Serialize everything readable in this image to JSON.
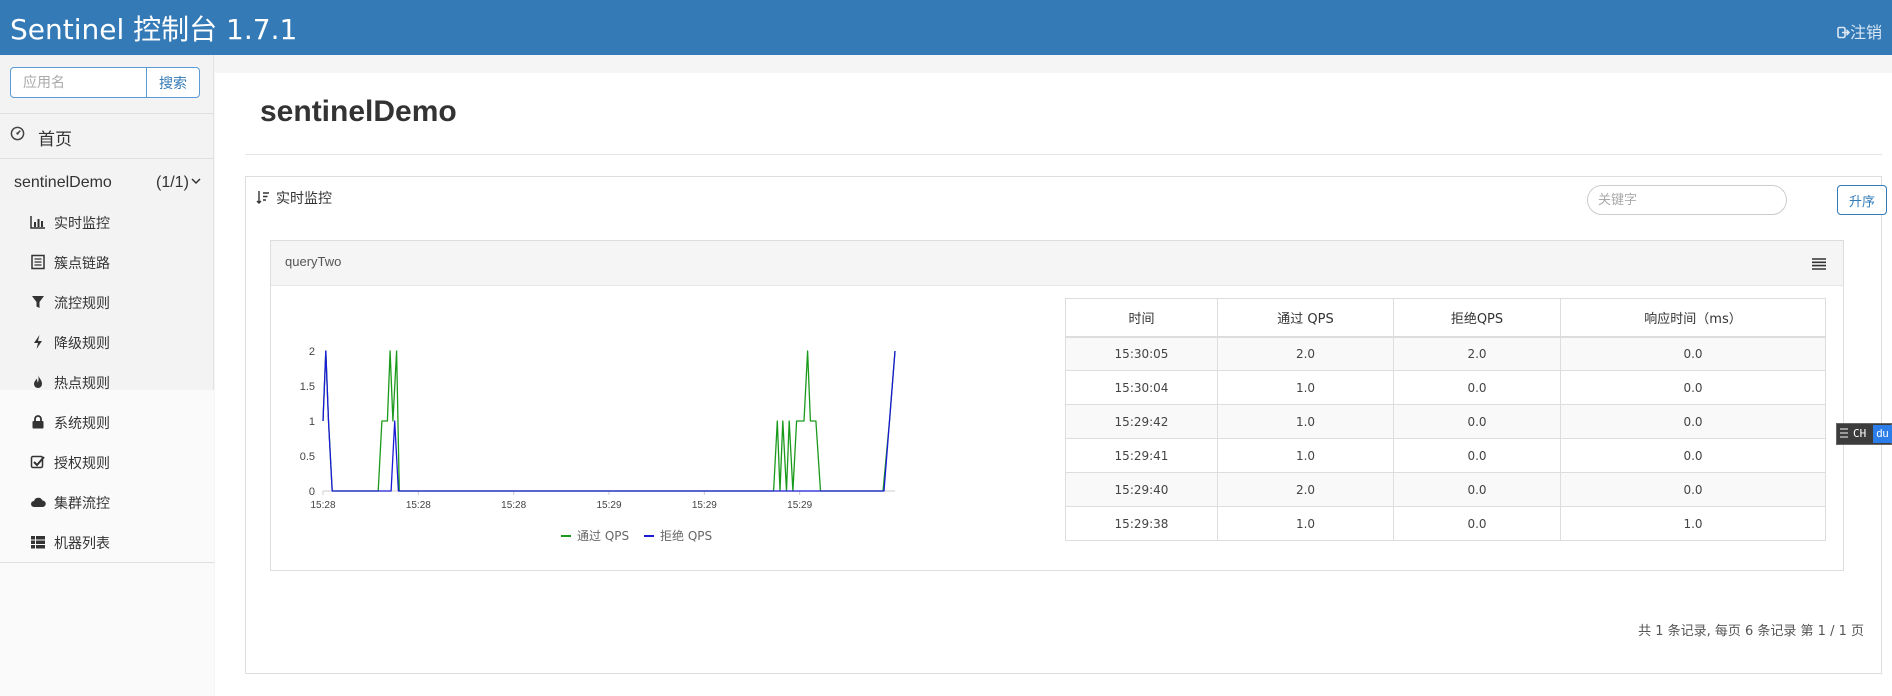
{
  "header": {
    "brand": "Sentinel 控制台 1.7.1",
    "logout_label": "注销"
  },
  "sidebar": {
    "search_placeholder": "应用名",
    "search_button": "搜索",
    "home_label": "首页",
    "app": {
      "name": "sentinelDemo",
      "count": "(1/1)"
    },
    "menu": [
      {
        "label": "实时监控",
        "icon": "bar-chart-icon"
      },
      {
        "label": "簇点链路",
        "icon": "list-icon"
      },
      {
        "label": "流控规则",
        "icon": "filter-icon"
      },
      {
        "label": "降级规则",
        "icon": "flash-icon"
      },
      {
        "label": "热点规则",
        "icon": "fire-icon"
      },
      {
        "label": "系统规则",
        "icon": "lock-icon"
      },
      {
        "label": "授权规则",
        "icon": "check-icon"
      },
      {
        "label": "集群流控",
        "icon": "cloud-icon"
      },
      {
        "label": "机器列表",
        "icon": "th-list-icon"
      }
    ]
  },
  "main": {
    "title": "sentinelDemo",
    "panel_title": "实时监控",
    "keyword_placeholder": "关键字",
    "sort_button": "升序",
    "resource": "queryTwo",
    "table": {
      "headers": [
        "时间",
        "通过 QPS",
        "拒绝QPS",
        "响应时间（ms）"
      ],
      "rows": [
        [
          "15:30:05",
          "2.0",
          "2.0",
          "0.0"
        ],
        [
          "15:30:04",
          "1.0",
          "0.0",
          "0.0"
        ],
        [
          "15:29:42",
          "1.0",
          "0.0",
          "0.0"
        ],
        [
          "15:29:41",
          "1.0",
          "0.0",
          "0.0"
        ],
        [
          "15:29:40",
          "2.0",
          "0.0",
          "0.0"
        ],
        [
          "15:29:38",
          "1.0",
          "0.0",
          "1.0"
        ]
      ]
    },
    "pager": "共 1 条记录, 每页 6 条记录 第 1 / 1 页"
  },
  "ime": {
    "mode": "CH",
    "logo": "du"
  },
  "chart_data": {
    "type": "line",
    "ylim": [
      0,
      2
    ],
    "yticks": [
      "0",
      "0.5",
      "1",
      "1.5",
      "2"
    ],
    "xticks": [
      "15:28",
      "15:28",
      "15:28",
      "15:29",
      "15:29",
      "15:29"
    ],
    "colors": {
      "pass": "#1a9a1a",
      "block": "#1a1ad6"
    },
    "series": [
      {
        "name": "通过 QPS",
        "points": [
          [
            0,
            1
          ],
          [
            3,
            2
          ],
          [
            6,
            1
          ],
          [
            10,
            0
          ],
          [
            60,
            0
          ],
          [
            64,
            1
          ],
          [
            70,
            1
          ],
          [
            73,
            2
          ],
          [
            76,
            1
          ],
          [
            80,
            2
          ],
          [
            83,
            0
          ],
          [
            490,
            0
          ],
          [
            494,
            1
          ],
          [
            497,
            0
          ],
          [
            500,
            1
          ],
          [
            504,
            0
          ],
          [
            507,
            1
          ],
          [
            511,
            0
          ],
          [
            515,
            1
          ],
          [
            523,
            1
          ],
          [
            527,
            2
          ],
          [
            530,
            1
          ],
          [
            536,
            1
          ],
          [
            541,
            0
          ],
          [
            609,
            0
          ],
          [
            616,
            1
          ],
          [
            622,
            2
          ]
        ]
      },
      {
        "name": "拒绝 QPS",
        "points": [
          [
            0,
            1
          ],
          [
            3,
            2
          ],
          [
            6,
            1
          ],
          [
            10,
            0
          ],
          [
            74,
            0
          ],
          [
            78,
            1
          ],
          [
            82,
            0
          ],
          [
            610,
            0
          ],
          [
            622,
            2
          ]
        ]
      }
    ]
  }
}
